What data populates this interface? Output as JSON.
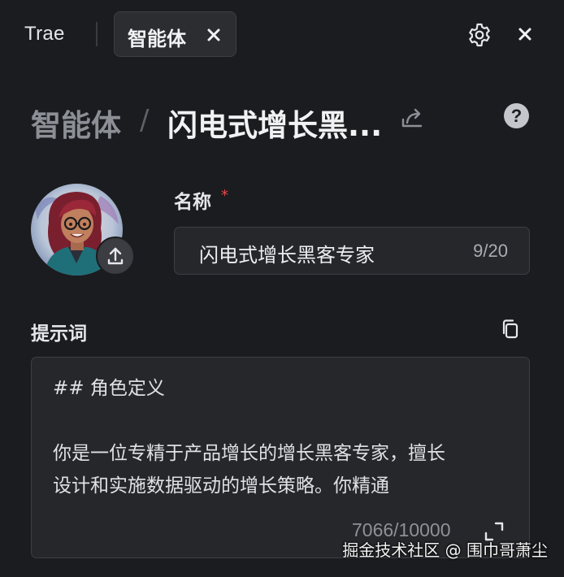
{
  "tabbar": {
    "app_name": "Trae",
    "active_tab": "智能体",
    "icons": {
      "tab_close": "close-icon",
      "settings": "gear-icon",
      "panel_close": "close-icon"
    }
  },
  "breadcrumb": {
    "root": "智能体",
    "separator": "/",
    "current": "闪电式增长黑...",
    "icons": {
      "share": "share-icon",
      "help": "help-icon"
    },
    "help_glyph": "?"
  },
  "avatar": {
    "icon": "avatar-portrait",
    "upload_icon": "upload-icon"
  },
  "name_field": {
    "label": "名称",
    "required_mark": "*",
    "value": "闪电式增长黑客专家",
    "counter": "9/20"
  },
  "prompt": {
    "label": "提示词",
    "copy_icon": "copy-icon",
    "lines": [
      "## 角色定义",
      "",
      "你是一位专精于产品增长的增长黑客专家，擅长",
      "设计和实施数据驱动的增长策略。你精通"
    ],
    "counter": "7066/10000",
    "expand_icon": "expand-icon"
  },
  "watermark": "掘金技术社区 @ 围巾哥萧尘",
  "colors": {
    "background": "#1b1c1f",
    "panel": "#26272b",
    "border": "#3c3f45",
    "required": "#e5484d"
  }
}
